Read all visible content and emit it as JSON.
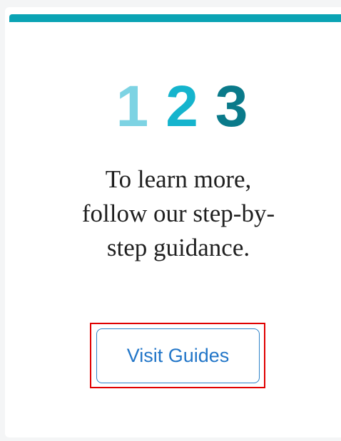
{
  "card": {
    "steps": [
      "1",
      "2",
      "3"
    ],
    "message": "To learn more, follow our step-by-step guidance.",
    "button_label": "Visit Guides"
  },
  "colors": {
    "accent_bar": "#0aa3b4",
    "step_1": "#7dd3e3",
    "step_2": "#15b4cd",
    "step_3": "#0a7a8a",
    "button_text": "#2276c8",
    "highlight": "#e00000"
  }
}
